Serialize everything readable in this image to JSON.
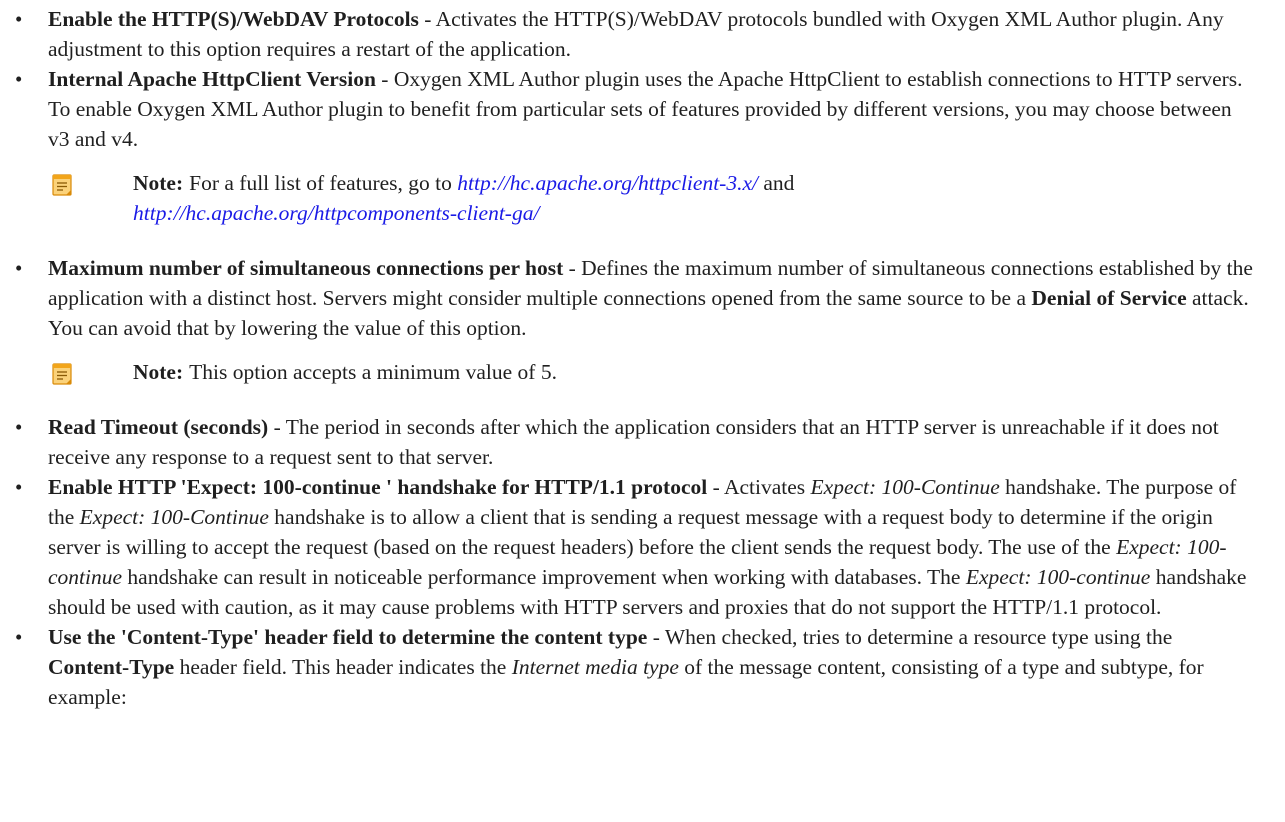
{
  "items": [
    {
      "term": "Enable the HTTP(S)/WebDAV Protocols",
      "sep": " - ",
      "text": "Activates the HTTP(S)/WebDAV protocols bundled with Oxygen XML Author plugin. Any adjustment to this option requires a restart of the application."
    },
    {
      "term": "Internal Apache HttpClient Version",
      "sep": " - ",
      "text": "Oxygen XML Author plugin uses the Apache HttpClient to establish connections to HTTP servers. To enable Oxygen XML Author plugin to benefit from particular sets of features provided by different versions, you may choose between v3 and v4.",
      "note": {
        "label": "Note:",
        "text_a": "For a full list of features, go to ",
        "link1": "http://hc.apache.org/httpclient-3.x/",
        "text_b": " and ",
        "link2": "http://hc.apache.org/httpcomponents-client-ga/"
      }
    },
    {
      "term": "Maximum number of simultaneous connections per host",
      "sep": " - ",
      "text_a": "Defines the maximum number of simultaneous connections established by the application with a distinct host. Servers might consider multiple connections opened from the same source to be a ",
      "bold": "Denial of Service",
      "text_b": " attack. You can avoid that by lowering the value of this option.",
      "note": {
        "label": "Note:",
        "text": "This option accepts a minimum value of 5."
      }
    },
    {
      "term": "Read Timeout (seconds)",
      "sep": " - ",
      "text": "The period in seconds after which the application considers that an HTTP server is unreachable if it does not receive any response to a request sent to that server."
    },
    {
      "term": "Enable HTTP 'Expect: 100-continue ' handshake for HTTP/1.1 protocol",
      "sep": " - ",
      "t1": "Activates ",
      "i1": "Expect: 100-Continue",
      "t2": " handshake. The purpose of the ",
      "i2": "Expect: 100-Continue",
      "t3": " handshake is to allow a client that is sending a request message with a request body to determine if the origin server is willing to accept the request (based on the request headers) before the client sends the request body. The use of the ",
      "i3": "Expect: 100-continue",
      "t4": " handshake can result in noticeable performance improvement when working with databases. The ",
      "i4": "Expect: 100-continue",
      "t5": " handshake should be used with caution, as it may cause problems with HTTP servers and proxies that do not support the HTTP/1.1 protocol."
    },
    {
      "term": "Use the 'Content-Type' header field to determine the content type",
      "sep": " - ",
      "t1": "When checked, tries to determine a resource type using the ",
      "b1": "Content-Type",
      "t2": " header field. This header indicates the ",
      "i1": "Internet media type",
      "t3": " of the message content, consisting of a type and subtype, for example:"
    }
  ],
  "icons": {
    "note": "note-icon"
  },
  "colors": {
    "link": "#1a1ae6",
    "note_icon": "#f2a51a"
  }
}
